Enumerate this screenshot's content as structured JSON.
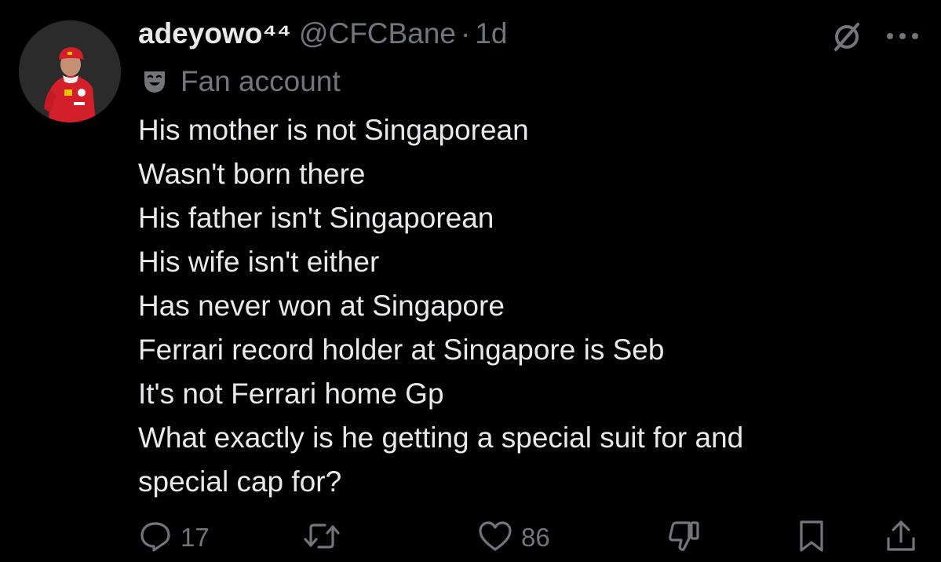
{
  "author": {
    "display_name": "adeyowo⁴⁴",
    "handle": "@CFCBane",
    "separator": "·",
    "time": "1d",
    "label": "Fan account"
  },
  "tweet": {
    "lines": [
      "His mother is not Singaporean",
      "Wasn't born there",
      "His father isn't Singaporean",
      "His wife isn't either",
      "Has never won at Singapore",
      "Ferrari record holder at Singapore is Seb",
      "It's not Ferrari home Gp",
      "What exactly is he getting a special suit for and",
      "special cap for?"
    ]
  },
  "actions": {
    "replies": "17",
    "reposts": "",
    "likes": "86"
  },
  "icons": {
    "grok": "grok-icon",
    "more": "more-icon",
    "label": "theater-masks-icon",
    "reply": "reply-icon",
    "repost": "repost-icon",
    "like": "heart-icon",
    "dislike": "dislike-icon",
    "bookmark": "bookmark-icon",
    "share": "share-icon"
  },
  "colors": {
    "background": "#000000",
    "text": "#e7e9ea",
    "muted": "#71767b",
    "avatar_red": "#c8102e"
  }
}
